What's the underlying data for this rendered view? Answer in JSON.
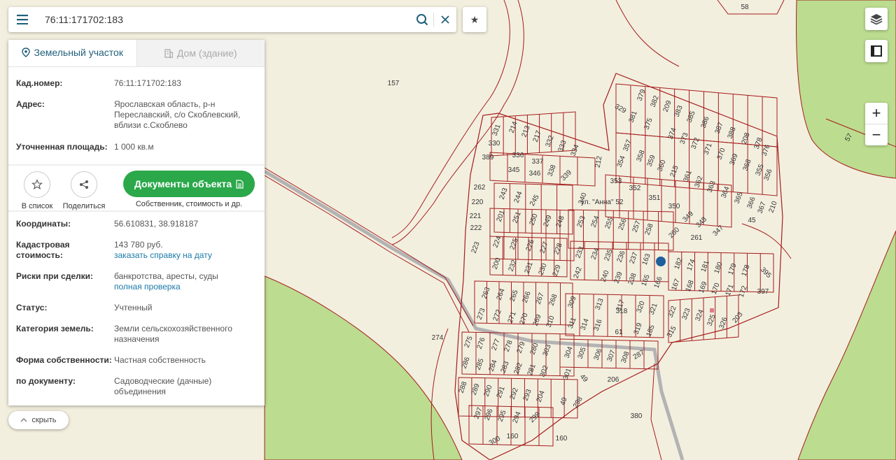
{
  "search": {
    "value": "76:11:171702:183"
  },
  "tabs": [
    {
      "label": "Земельный участок",
      "icon": "map-pin-icon",
      "active": true
    },
    {
      "label": "Дом (здание)",
      "icon": "building-icon",
      "active": false
    }
  ],
  "parcel": {
    "cadastral_label": "Кад.номер:",
    "cadastral_value": "76:11:171702:183",
    "address_label": "Адрес:",
    "address_value": "Ярославская область, р-н Переславский, с/о Скоблевский, вблизи с.Скоблево",
    "area_label": "Уточненная площадь:",
    "area_value": "1 000 кв.м"
  },
  "actions": {
    "favorite_label": "В список",
    "share_label": "Поделиться",
    "docs_button": "Документы объекта",
    "docs_sub": "Собственник, стоимость и др."
  },
  "details": {
    "coords_label": "Координаты:",
    "coords_value": "56.610831, 38.918187",
    "cost_label": "Кадастровая стоимость:",
    "cost_value": "143 780 руб.",
    "cost_link": "заказать справку на дату",
    "risks_label": "Риски при сделки:",
    "risks_value": "банкротства, аресты, суды",
    "risks_link": "полная проверка",
    "status_label": "Статус:",
    "status_value": "Учтенный",
    "category_label": "Категория земель:",
    "category_value": "Земли сельскохозяйственного назначения",
    "ownership_label": "Форма собственности:",
    "ownership_value": "Частная собственность",
    "doc_label": "по документу:",
    "doc_value": "Садоводческие (дачные) объединения"
  },
  "hide_button": "скрыть",
  "map": {
    "colors": {
      "land": "#f3efdf",
      "forest": "#bcdc8f",
      "boundary": "#a51c1c",
      "marker": "#1f5f9e"
    },
    "street_label": "ул. \"Анна\" 52",
    "labels": [
      "58",
      "157",
      "329",
      "331",
      "214",
      "213",
      "217",
      "332",
      "333",
      "334",
      "330",
      "336",
      "337",
      "212",
      "389",
      "345",
      "346",
      "338",
      "339",
      "262",
      "243",
      "244",
      "245",
      "220",
      "201",
      "251",
      "250",
      "249",
      "248",
      "253",
      "254",
      "255",
      "256",
      "257",
      "258",
      "260",
      "261",
      "221",
      "222",
      "224",
      "225",
      "226",
      "227",
      "228",
      "233",
      "234",
      "235",
      "236",
      "237",
      "163",
      "182",
      "174",
      "181",
      "180",
      "179",
      "178",
      "395",
      "223",
      "200",
      "232",
      "231",
      "230",
      "229",
      "242",
      "240",
      "239",
      "238",
      "165",
      "166",
      "167",
      "168",
      "169",
      "170",
      "171",
      "172",
      "397",
      "263",
      "264",
      "265",
      "266",
      "267",
      "268",
      "309",
      "313",
      "317",
      "320",
      "321",
      "322",
      "323",
      "324",
      "325",
      "326",
      "203",
      "273",
      "272",
      "271",
      "270",
      "269",
      "310",
      "311",
      "314",
      "316",
      "318",
      "319",
      "185",
      "315",
      "61",
      "274",
      "275",
      "276",
      "277",
      "278",
      "279",
      "280",
      "303",
      "304",
      "305",
      "306",
      "307",
      "308",
      "287",
      "286",
      "285",
      "284",
      "283",
      "282",
      "281",
      "302",
      "301",
      "49",
      "206",
      "288",
      "289",
      "290",
      "291",
      "292",
      "293",
      "204",
      "49",
      "298",
      "297",
      "296",
      "295",
      "294",
      "299",
      "300",
      "160",
      "160",
      "380",
      "379",
      "381",
      "382",
      "209",
      "383",
      "385",
      "386",
      "387",
      "388",
      "208",
      "378",
      "376",
      "375",
      "374",
      "373",
      "372",
      "371",
      "370",
      "369",
      "368",
      "355",
      "356",
      "357",
      "358",
      "359",
      "360",
      "215",
      "361",
      "362",
      "363",
      "364",
      "365",
      "366",
      "367",
      "210",
      "354",
      "353",
      "352",
      "351",
      "350",
      "349",
      "348",
      "347",
      "45",
      "340",
      "57"
    ]
  }
}
